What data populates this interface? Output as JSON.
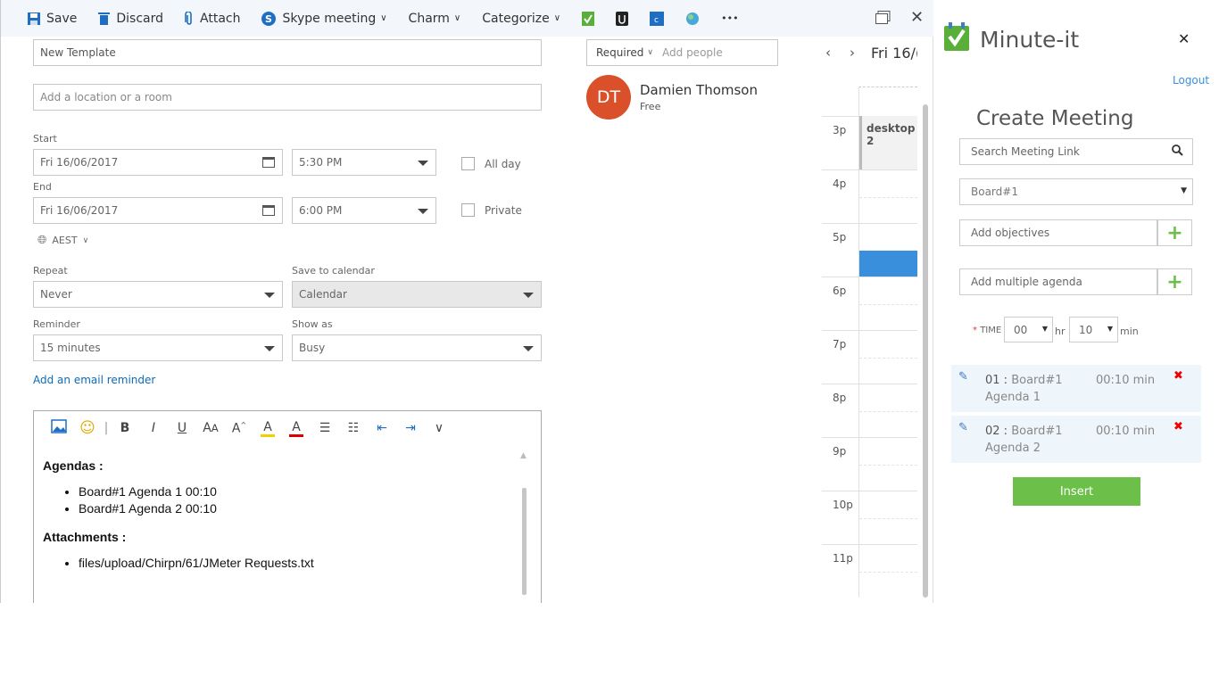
{
  "toolbar": {
    "save": "Save",
    "discard": "Discard",
    "attach": "Attach",
    "skype": "Skype meeting",
    "charm": "Charm",
    "categorize": "Categorize",
    "more": "•••"
  },
  "form": {
    "title": "New Template",
    "location_placeholder": "Add a location or a room",
    "start_label": "Start",
    "start_date": "Fri 16/06/2017",
    "start_time": "5:30 PM",
    "all_day": "All day",
    "end_label": "End",
    "end_date": "Fri 16/06/2017",
    "end_time": "6:00 PM",
    "private": "Private",
    "timezone": "AEST",
    "repeat_label": "Repeat",
    "repeat": "Never",
    "save_to_label": "Save to calendar",
    "save_to": "Calendar",
    "reminder_label": "Reminder",
    "reminder": "15 minutes",
    "show_as_label": "Show as",
    "show_as": "Busy",
    "email_reminder": "Add an email reminder"
  },
  "attendees": {
    "required": "Required",
    "add_placeholder": "Add people",
    "people": [
      {
        "initials": "DT",
        "name": "Damien Thomson",
        "status": "Free",
        "color": "#d9502a"
      }
    ]
  },
  "editor": {
    "agendas_heading": "Agendas :",
    "agendas": [
      "Board#1 Agenda 1 00:10",
      "Board#1 Agenda 2 00:10"
    ],
    "attachments_heading": "Attachments :",
    "attachments": [
      "files/upload/Chirpn/61/JMeter Requests.txt"
    ]
  },
  "calendar": {
    "date": "Fri 16/(",
    "hours": [
      "3p",
      "4p",
      "5p",
      "6p",
      "7p",
      "8p",
      "9p",
      "10p",
      "11p"
    ],
    "event": "desktop 2",
    "accent": "#3a8fdc"
  },
  "addin": {
    "name": "Minute-it",
    "logout": "Logout",
    "heading": "Create Meeting",
    "search_placeholder": "Search Meeting Link",
    "board": "Board#1",
    "objectives_placeholder": "Add objectives",
    "agenda_placeholder": "Add multiple agenda",
    "time_label": "TIME",
    "hours": "00",
    "hr": "hr",
    "minutes": "10",
    "min": "min",
    "agenda_items": [
      {
        "num": "01 :",
        "board": "Board#1",
        "title": "Agenda 1",
        "duration": "00:10 min"
      },
      {
        "num": "02 :",
        "board": "Board#1",
        "title": "Agenda 2",
        "duration": "00:10 min"
      }
    ],
    "insert": "Insert",
    "brand_color": "#6cc04a"
  }
}
